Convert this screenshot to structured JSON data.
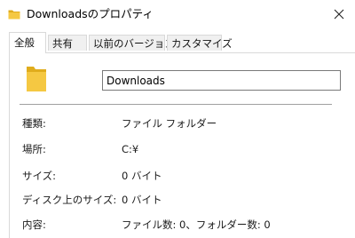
{
  "window": {
    "title": "Downloadsのプロパティ"
  },
  "tabs": [
    {
      "label": "全般",
      "active": true
    },
    {
      "label": "共有",
      "active": false
    },
    {
      "label": "以前のバージョン",
      "active": false
    },
    {
      "label": "カスタマイズ",
      "active": false
    }
  ],
  "general": {
    "folder_name": "Downloads",
    "properties": [
      {
        "label": "種類:",
        "value": "ファイル フォルダー"
      },
      {
        "label": "場所:",
        "value": "C:¥"
      },
      {
        "label": "サイズ:",
        "value": "0 バイト"
      },
      {
        "label": "ディスク上のサイズ:",
        "value": "0 バイト"
      },
      {
        "label": "内容:",
        "value": "ファイル数: 0、フォルダー数: 0"
      }
    ]
  },
  "icons": {
    "title_icon": "folder-icon",
    "close": "close-icon",
    "folder_large": "folder-icon"
  },
  "colors": {
    "folder": "#f5c842",
    "folder_dark": "#e0ac1c",
    "border": "#d9d9d9",
    "separator": "#a0a0a0"
  }
}
